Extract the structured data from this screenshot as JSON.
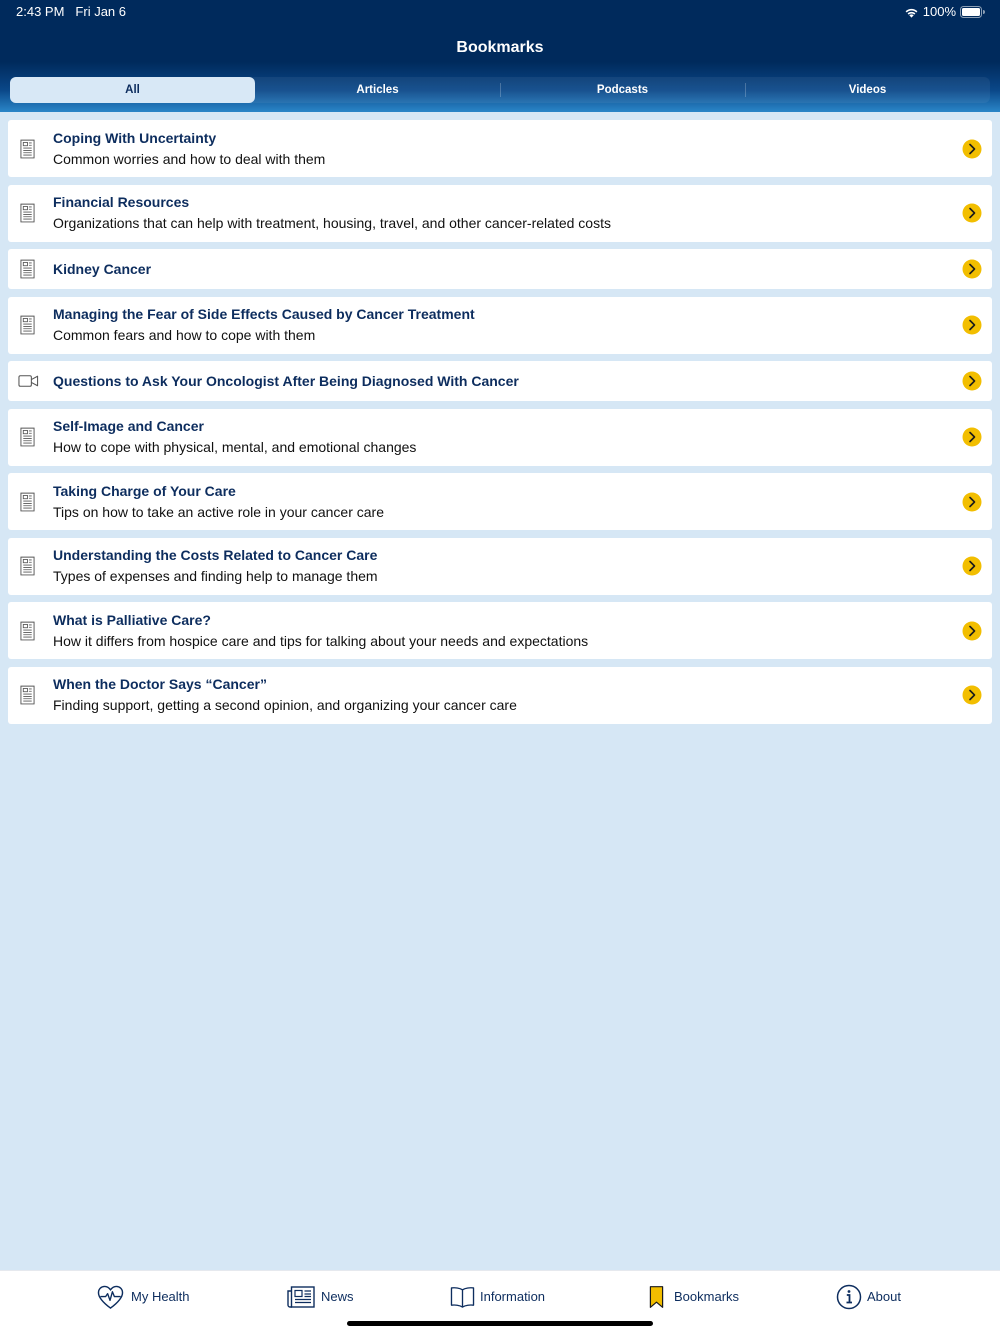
{
  "status_bar": {
    "time": "2:43 PM",
    "date": "Fri Jan 6",
    "battery_level": "100%",
    "icons": [
      "wifi-icon",
      "battery-icon"
    ]
  },
  "header": {
    "title": "Bookmarks"
  },
  "filter_segments": [
    {
      "label": "All",
      "selected": true
    },
    {
      "label": "Articles",
      "selected": false
    },
    {
      "label": "Podcasts",
      "selected": false
    },
    {
      "label": "Videos",
      "selected": false
    }
  ],
  "bookmarks": [
    {
      "icon": "document-icon",
      "title": "Coping With Uncertainty",
      "subtitle": "Common worries and how to deal with them"
    },
    {
      "icon": "document-icon",
      "title": "Financial Resources",
      "subtitle": "Organizations that can help with treatment, housing, travel, and other cancer-related costs"
    },
    {
      "icon": "document-icon",
      "title": "Kidney Cancer"
    },
    {
      "icon": "document-icon",
      "title": "Managing the Fear of Side Effects Caused by Cancer Treatment",
      "subtitle": "Common fears and how to cope with them"
    },
    {
      "icon": "video-camera-icon",
      "title": "Questions to Ask Your Oncologist After Being Diagnosed With Cancer"
    },
    {
      "icon": "document-icon",
      "title": "Self-Image and Cancer",
      "subtitle": "How to cope with physical, mental, and emotional changes"
    },
    {
      "icon": "document-icon",
      "title": "Taking Charge of Your Care",
      "subtitle": "Tips on how to take an active role in your cancer care"
    },
    {
      "icon": "document-icon",
      "title": "Understanding the Costs Related to Cancer Care",
      "subtitle": "Types of expenses and finding help to manage them"
    },
    {
      "icon": "document-icon",
      "title": "What is Palliative Care?",
      "subtitle": "How it differs from hospice care and tips for talking about your needs and expectations"
    },
    {
      "icon": "document-icon",
      "title": "When the Doctor Says “Cancer”",
      "subtitle": "Finding support, getting a second opinion, and organizing your cancer care"
    }
  ],
  "row_action_icon": "chevron-right-icon",
  "tab_bar": [
    {
      "label": "My Health",
      "icon": "heart-pulse-icon",
      "selected": false
    },
    {
      "label": "News",
      "icon": "newspaper-icon",
      "selected": false
    },
    {
      "label": "Information",
      "icon": "open-book-icon",
      "selected": false
    },
    {
      "label": "Bookmarks",
      "icon": "bookmark-icon",
      "selected": true
    },
    {
      "label": "About",
      "icon": "info-circle-icon",
      "selected": false
    }
  ],
  "colors": {
    "header_navy": "#002a5c",
    "header_blue": "#2a86c8",
    "background": "#d6e7f5",
    "title_text": "#0d2d5e",
    "accent_yellow": "#f2be00",
    "selected_segment": "#d8e8f6",
    "card": "#ffffff"
  }
}
